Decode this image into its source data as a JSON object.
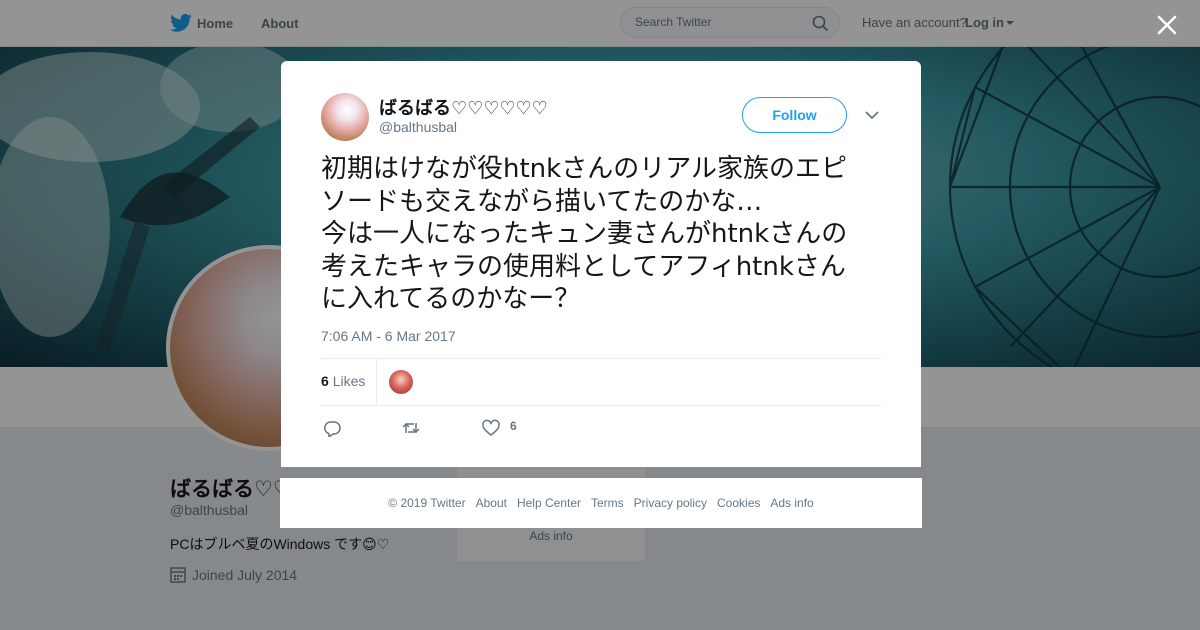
{
  "topbar": {
    "home": "Home",
    "about": "About",
    "search_placeholder": "Search Twitter",
    "have_account": "Have an account?",
    "login": "Log in"
  },
  "profile": {
    "name": "ばるばる♡♡♡♡♡♡",
    "handle": "@balthusbal",
    "bio": "PCはブルベ夏のWindows です😊♡",
    "joined": "Joined July 2014",
    "side_ads": "Ads info"
  },
  "tweet": {
    "display_name": "ばるばる♡♡♡♡♡♡",
    "username": "@balthusbal",
    "follow": "Follow",
    "text_lines": [
      "初期はけなが役htnkさんのリアル家族のエピ",
      "ソードも交えながら描いてたのかな…",
      "今は一人になったキュン妻さんがhtnkさんの",
      "考えたキャラの使用料としてアフィhtnkさん",
      "に入れてるのかなー？"
    ],
    "timestamp": "7:06 AM - 6 Mar 2017",
    "likes_number": "6",
    "likes_label": "Likes",
    "like_action_count": "6"
  },
  "footer": {
    "links": [
      "© 2019 Twitter",
      "About",
      "Help Center",
      "Terms",
      "Privacy policy",
      "Cookies",
      "Ads info"
    ]
  },
  "icons": {
    "brand": "twitter-bird-icon",
    "close": "close-icon",
    "reply": "reply-icon",
    "retweet": "retweet-icon",
    "like": "heart-icon"
  },
  "colors": {
    "accent": "#1da1f2",
    "text": "#14171a",
    "muted": "#657786"
  }
}
